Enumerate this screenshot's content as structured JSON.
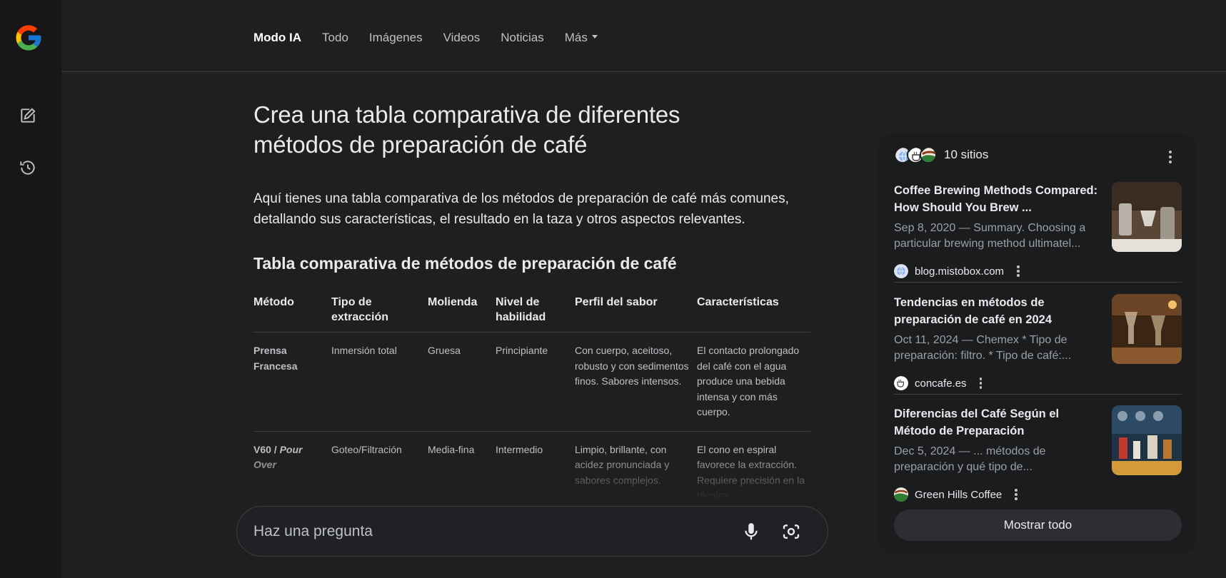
{
  "nav": {
    "tabs": [
      {
        "label": "Modo IA"
      },
      {
        "label": "Todo"
      },
      {
        "label": "Imágenes"
      },
      {
        "label": "Videos"
      },
      {
        "label": "Noticias"
      },
      {
        "label": "Más"
      }
    ]
  },
  "main": {
    "query": "Crea una tabla comparativa de diferentes métodos de preparación de café",
    "intro": "Aquí tienes una tabla comparativa de los métodos de preparación de café más comunes, detallando sus características, el resultado en la taza y otros aspectos relevantes.",
    "table_title": "Tabla comparativa de métodos de preparación de café",
    "table": {
      "headers": [
        "Método",
        "Tipo de extracción",
        "Molienda",
        "Nivel de habilidad",
        "Perfil del sabor",
        "Características"
      ],
      "rows": [
        {
          "method": "Prensa Francesa",
          "method_italic": "",
          "extraction": "Inmersión total",
          "grind": "Gruesa",
          "skill": "Principiante",
          "flavor": "Con cuerpo, aceitoso, robusto y con sedimentos finos. Sabores intensos.",
          "features": "El contacto prolongado del café con el agua produce una bebida intensa y con más cuerpo."
        },
        {
          "method": "V60 / ",
          "method_italic": "Pour Over",
          "extraction": "Goteo/Filtración",
          "grind": "Media-fina",
          "skill": "Intermedio",
          "flavor": "Limpio, brillante, con acidez pronunciada y sabores complejos.",
          "features": "El cono en espiral favorece la extracción. Requiere precisión en la técnica."
        }
      ]
    }
  },
  "ask": {
    "placeholder": "Haz una pregunta"
  },
  "sources": {
    "count_label": "10 sitios",
    "cards": [
      {
        "title": "Coffee Brewing Methods Compared: How Should You Brew ...",
        "snippet": "Sep 8, 2020 — Summary. Choosing a particular brewing method ultimatel...",
        "site": "blog.mistobox.com"
      },
      {
        "title": "Tendencias en métodos de preparación de café en 2024",
        "snippet": "Oct 11, 2024 — Chemex * Tipo de preparación: filtro. * Tipo de café:...",
        "site": "concafe.es"
      },
      {
        "title": "Diferencias del Café Según el Método de Preparación",
        "snippet": "Dec 5, 2024 — ... métodos de preparación y qué tipo de...",
        "site": "Green Hills Coffee"
      }
    ],
    "show_all": "Mostrar todo"
  },
  "icons": {
    "logo": "google-g-icon",
    "new_chat": "edit-icon",
    "history": "history-icon",
    "mic": "mic-icon",
    "lens": "camera-lens-icon"
  }
}
